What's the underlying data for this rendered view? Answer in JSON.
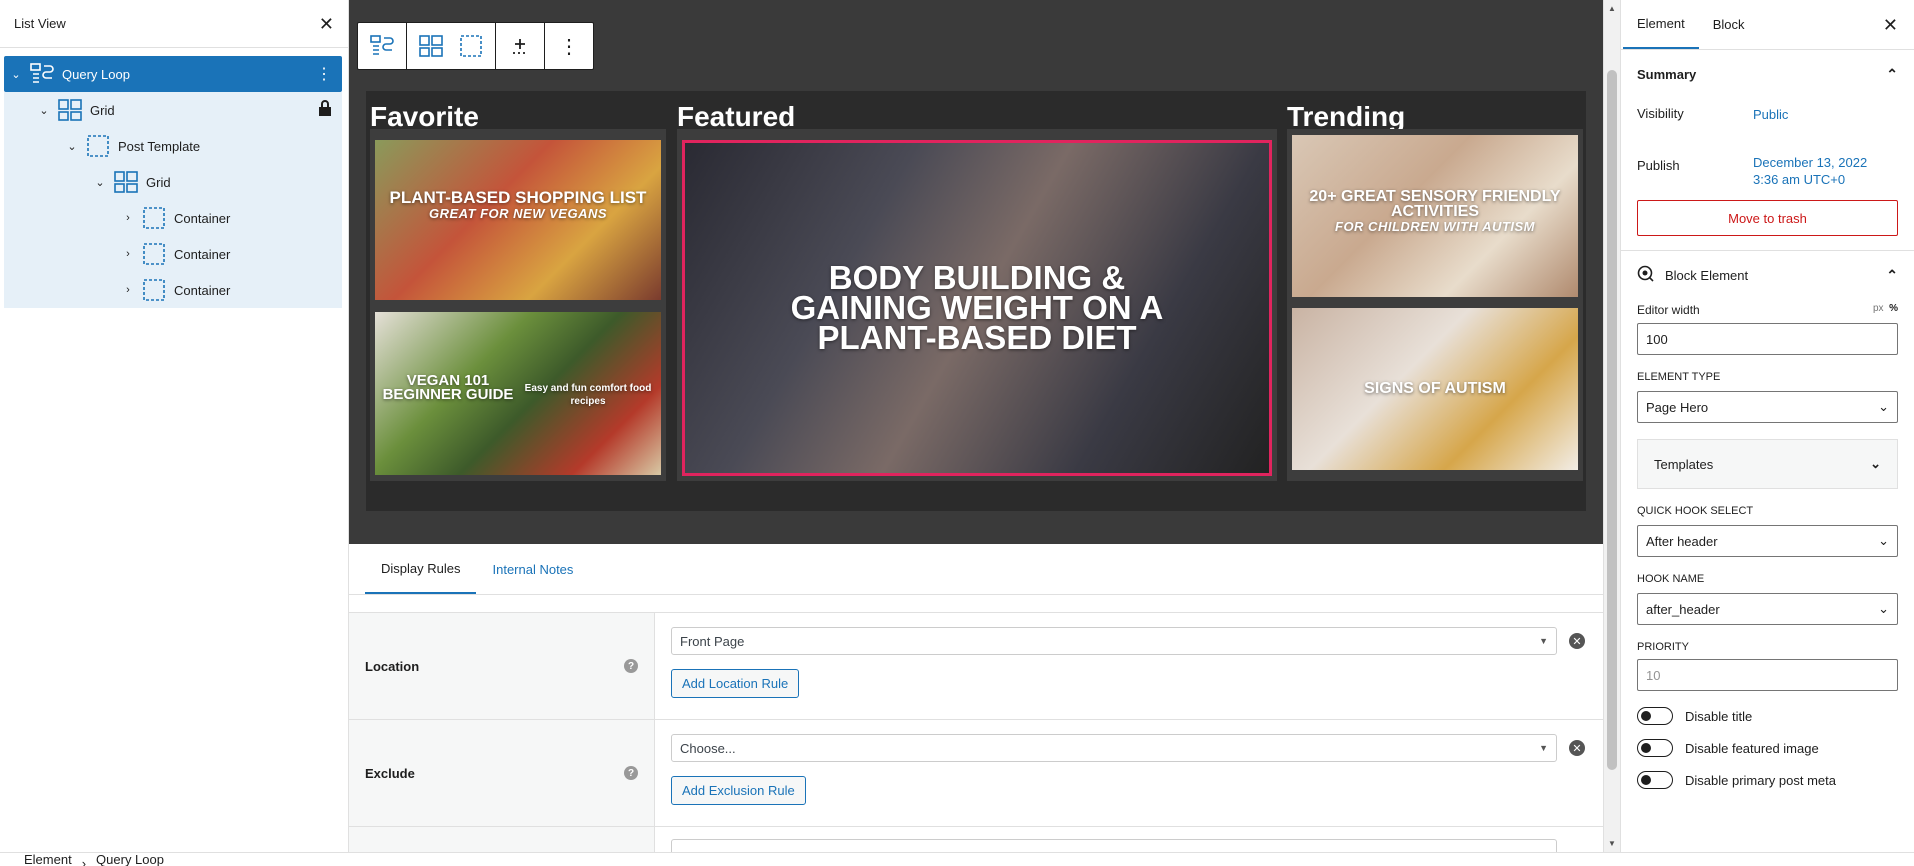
{
  "list_view": {
    "title": "List View",
    "items": [
      {
        "label": "Query Loop",
        "icon": "query-loop-icon"
      },
      {
        "label": "Grid",
        "icon": "grid-icon"
      },
      {
        "label": "Post Template",
        "icon": "container-icon"
      },
      {
        "label": "Grid",
        "icon": "grid-icon"
      },
      {
        "label": "Container",
        "icon": "container-icon"
      },
      {
        "label": "Container",
        "icon": "container-icon"
      },
      {
        "label": "Container",
        "icon": "container-icon"
      }
    ]
  },
  "canvas": {
    "columns": [
      "Favorite",
      "Featured",
      "Trending"
    ],
    "tiles": {
      "fav1": {
        "title": "PLANT-BASED SHOPPING LIST",
        "sub": "GREAT FOR NEW VEGANS"
      },
      "fav2": {
        "title": "VEGAN 101 BEGINNER GUIDE",
        "sub": "Easy and fun comfort food recipes"
      },
      "featured": {
        "title": "BODY BUILDING & GAINING WEIGHT ON A PLANT-BASED DIET"
      },
      "trend1": {
        "title": "20+ GREAT SENSORY FRIENDLY ACTIVITIES",
        "sub": "FOR CHILDREN WITH AUTISM"
      },
      "trend2": {
        "title": "SIGNS OF AUTISM"
      }
    },
    "colors": {
      "canvas_bg": "#3a3a3a",
      "highlight": "#e0245e"
    }
  },
  "metabox": {
    "tabs": [
      "Display Rules",
      "Internal Notes"
    ],
    "location": {
      "label": "Location",
      "value": "Front Page",
      "button": "Add Location Rule"
    },
    "exclude": {
      "label": "Exclude",
      "placeholder": "Choose...",
      "button": "Add Exclusion Rule"
    }
  },
  "sidebar": {
    "tabs": [
      "Element",
      "Block"
    ],
    "summary": {
      "title": "Summary",
      "visibility_label": "Visibility",
      "visibility_value": "Public",
      "publish_label": "Publish",
      "publish_value_1": "December 13, 2022",
      "publish_value_2": "3:36 am UTC+0",
      "trash": "Move to trash"
    },
    "block_element": {
      "title": "Block Element",
      "editor_width_label": "Editor width",
      "unit_px": "px",
      "unit_pct": "%",
      "editor_width_value": "100",
      "element_type_label": "ELEMENT TYPE",
      "element_type_value": "Page Hero",
      "templates": "Templates",
      "quick_hook_label": "QUICK HOOK SELECT",
      "quick_hook_value": "After header",
      "hook_name_label": "HOOK NAME",
      "hook_name_value": "after_header",
      "priority_label": "PRIORITY",
      "priority_placeholder": "10",
      "toggles": [
        "Disable title",
        "Disable featured image",
        "Disable primary post meta"
      ]
    }
  },
  "breadcrumb": [
    "Element",
    "Query Loop"
  ]
}
